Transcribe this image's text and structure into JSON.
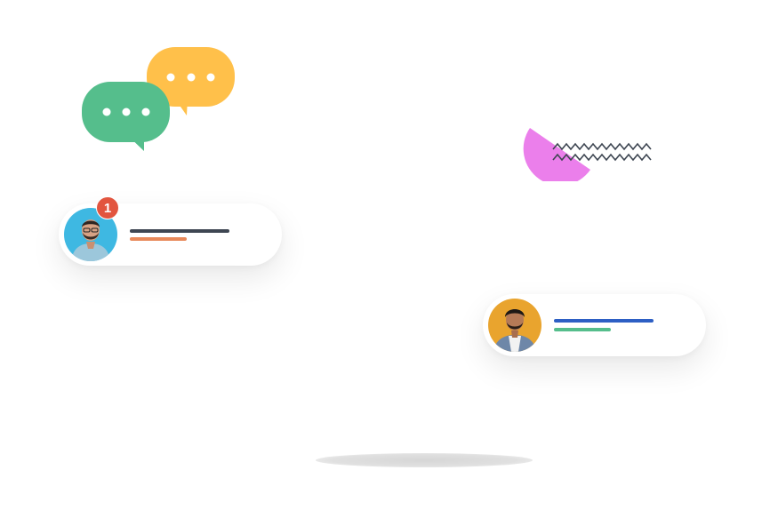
{
  "illustration": {
    "bubbles": {
      "front_color": "#55BE8C",
      "back_color": "#FFC04A",
      "icon": "chat-bubbles-icon"
    },
    "decoration": {
      "circle_color": "#EB7FEB",
      "zigzag_color": "#3E4652"
    },
    "floor_shadow_color": "#E2E2E2"
  },
  "cards": [
    {
      "avatar_bg": "#3EB8E2",
      "avatar_icon": "avatar-man-glasses",
      "badge_count": "1",
      "badge_color": "#E2553F",
      "line_primary_color": "#3E4652",
      "line_secondary_color": "#E8895A"
    },
    {
      "avatar_bg": "#E9A42E",
      "avatar_icon": "avatar-man-jacket",
      "line_primary_color": "#2D5FC4",
      "line_secondary_color": "#55BE8C"
    }
  ]
}
